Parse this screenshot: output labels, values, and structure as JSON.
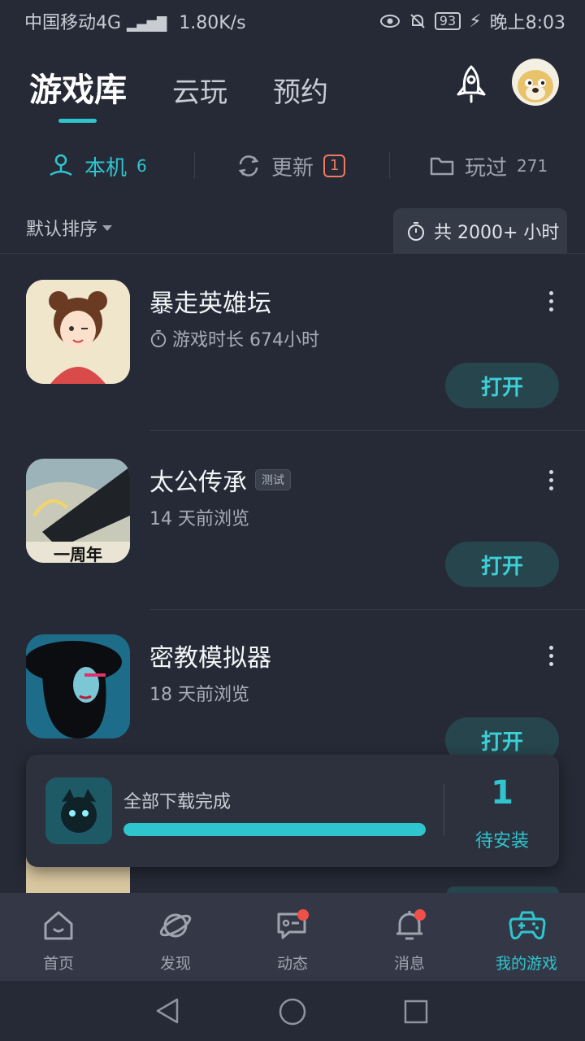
{
  "status_bar": {
    "carrier": "中国移动4G",
    "speed": "1.80K/s",
    "battery": "93",
    "time": "晚上8:03"
  },
  "header": {
    "tabs": [
      "游戏库",
      "云玩",
      "预约"
    ]
  },
  "subtabs": {
    "local": {
      "label": "本机",
      "count": "6"
    },
    "update": {
      "label": "更新",
      "count": "1"
    },
    "played": {
      "label": "玩过",
      "count": "271"
    }
  },
  "sort_label": "默认排序",
  "total_hours": "共 2000+ 小时",
  "games": [
    {
      "name": "暴走英雄坛",
      "sub": "游戏时长 674小时",
      "button": "打开"
    },
    {
      "name": "太公传承",
      "badge": "测试",
      "sub": "14 天前浏览",
      "button": "打开",
      "icon_text": "一周年"
    },
    {
      "name": "密教模拟器",
      "sub": "18 天前浏览",
      "button": "打开"
    }
  ],
  "download": {
    "text": "全部下载完成",
    "progress": 1.0,
    "pending_count": "1",
    "pending_label": "待安装"
  },
  "nav": [
    "首页",
    "发现",
    "动态",
    "消息",
    "我的游戏"
  ],
  "colors": {
    "accent": "#2fc5cf",
    "background": "#262a36",
    "alert": "#f0504a"
  }
}
